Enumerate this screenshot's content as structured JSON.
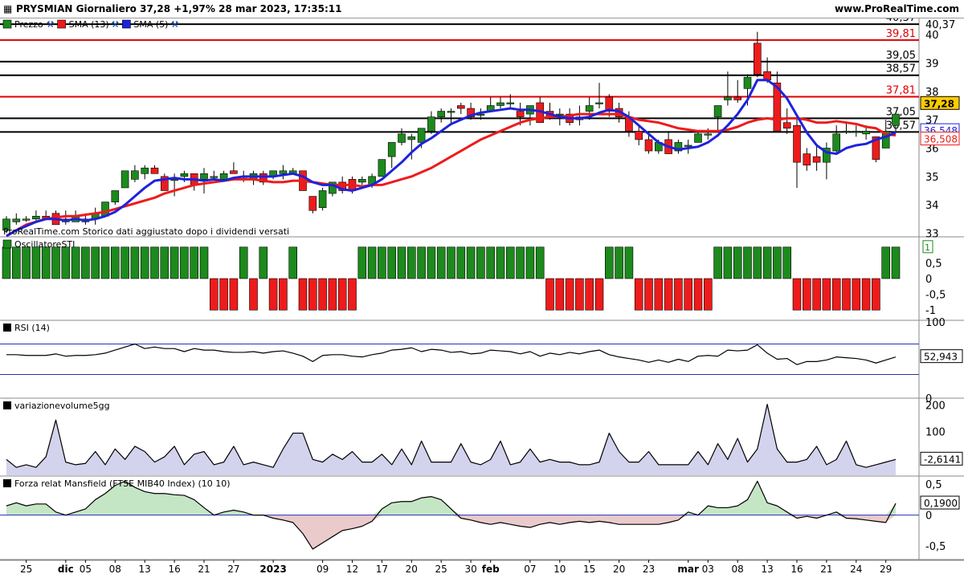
{
  "header": {
    "title": "PRYSMIAN Giornaliero 37,28 +1,97% 28 mar 2023, 17:35:11",
    "site": "www.ProRealTime.com"
  },
  "watermark": "ProRealTime.com",
  "note": "Storico dati aggiustato dopo i dividendi versati",
  "colors": {
    "up": "#1c8a1c",
    "down": "#ee1b1b",
    "sma13": "#ee1b1b",
    "sma5": "#1e22dd",
    "hline_black": "#000000",
    "hline_red": "#dd0000"
  },
  "chart_data": [
    {
      "type": "candlestick",
      "panel": "price",
      "legend": [
        "Prezzo",
        "SMA (13)",
        "SMA (5)"
      ],
      "y_ticks": [
        "33",
        "34",
        "35",
        "36",
        "37",
        "38",
        "39",
        "40",
        "40,37"
      ],
      "ylim": [
        32.9,
        40.6
      ],
      "x_tick_labels": [
        "25",
        "dic",
        "05",
        "08",
        "13",
        "16",
        "21",
        "27",
        "2023",
        "09",
        "12",
        "17",
        "20",
        "25",
        "30",
        "feb",
        "07",
        "10",
        "15",
        "20",
        "23",
        "mar",
        "03",
        "08",
        "13",
        "16",
        "21",
        "24",
        "29"
      ],
      "x_tick_index": [
        2,
        6,
        8,
        11,
        14,
        17,
        20,
        23,
        27,
        32,
        35,
        38,
        41,
        44,
        47,
        49,
        53,
        56,
        59,
        62,
        65,
        69,
        71,
        74,
        77,
        80,
        83,
        86,
        89
      ],
      "horizontal_levels": [
        {
          "value": 40.37,
          "label": "40,37",
          "color": "black"
        },
        {
          "value": 39.81,
          "label": "39,81",
          "color": "red"
        },
        {
          "value": 39.05,
          "label": "39,05",
          "color": "black"
        },
        {
          "value": 38.57,
          "label": "38,57",
          "color": "black"
        },
        {
          "value": 37.81,
          "label": "37,81",
          "color": "red"
        },
        {
          "value": 37.05,
          "label": "37,05",
          "color": "black"
        },
        {
          "value": 36.57,
          "label": "36,57",
          "color": "black"
        }
      ],
      "price_tags": [
        {
          "value": 37.28,
          "label": "37,28",
          "kind": "price"
        },
        {
          "value": 36.548,
          "label": "36,548",
          "kind": "sma5"
        },
        {
          "value": 36.508,
          "label": "36,508",
          "kind": "sma13"
        }
      ],
      "ohlc": [
        [
          33.1,
          33.6,
          33.0,
          33.5
        ],
        [
          33.4,
          33.7,
          33.3,
          33.5
        ],
        [
          33.5,
          33.6,
          33.4,
          33.5
        ],
        [
          33.5,
          33.8,
          33.4,
          33.6
        ],
        [
          33.6,
          33.8,
          33.5,
          33.5
        ],
        [
          33.7,
          33.8,
          33.3,
          33.3
        ],
        [
          33.4,
          33.8,
          33.3,
          33.5
        ],
        [
          33.4,
          33.8,
          33.4,
          33.6
        ],
        [
          33.4,
          33.7,
          33.3,
          33.5
        ],
        [
          33.5,
          33.9,
          33.3,
          33.7
        ],
        [
          33.6,
          34.1,
          33.6,
          34.1
        ],
        [
          34.1,
          34.5,
          34.0,
          34.5
        ],
        [
          34.6,
          35.2,
          34.6,
          35.2
        ],
        [
          34.9,
          35.4,
          34.8,
          35.2
        ],
        [
          35.1,
          35.4,
          34.9,
          35.3
        ],
        [
          35.3,
          35.4,
          35.1,
          35.1
        ],
        [
          35.0,
          35.1,
          34.5,
          34.5
        ],
        [
          34.9,
          35.1,
          34.3,
          34.9
        ],
        [
          35.0,
          35.2,
          34.8,
          35.1
        ],
        [
          35.1,
          35.1,
          34.5,
          34.7
        ],
        [
          34.9,
          35.3,
          34.4,
          35.1
        ],
        [
          35.0,
          35.2,
          34.9,
          35.0
        ],
        [
          34.9,
          35.2,
          34.9,
          35.1
        ],
        [
          35.2,
          35.5,
          35.1,
          35.1
        ],
        [
          35.0,
          35.2,
          34.8,
          35.0
        ],
        [
          34.9,
          35.2,
          34.7,
          35.1
        ],
        [
          35.1,
          35.2,
          34.7,
          34.8
        ],
        [
          35.0,
          35.2,
          34.9,
          35.2
        ],
        [
          35.1,
          35.4,
          34.9,
          35.2
        ],
        [
          35.1,
          35.3,
          35.1,
          35.2
        ],
        [
          35.2,
          35.2,
          34.5,
          34.5
        ],
        [
          34.3,
          34.3,
          33.7,
          33.8
        ],
        [
          33.9,
          34.6,
          33.8,
          34.5
        ],
        [
          34.4,
          34.8,
          34.3,
          34.8
        ],
        [
          34.8,
          35.0,
          34.4,
          34.5
        ],
        [
          34.9,
          35.0,
          34.4,
          34.5
        ],
        [
          34.8,
          35.0,
          34.7,
          34.9
        ],
        [
          34.7,
          35.1,
          34.6,
          35.0
        ],
        [
          35.0,
          35.6,
          35.0,
          35.6
        ],
        [
          35.7,
          36.2,
          35.3,
          36.2
        ],
        [
          36.2,
          36.7,
          36.1,
          36.5
        ],
        [
          36.3,
          36.5,
          35.6,
          36.4
        ],
        [
          36.2,
          36.7,
          36.0,
          36.7
        ],
        [
          36.6,
          37.3,
          36.5,
          37.1
        ],
        [
          37.1,
          37.4,
          36.9,
          37.3
        ],
        [
          37.3,
          37.4,
          36.8,
          37.3
        ],
        [
          37.5,
          37.6,
          37.2,
          37.4
        ],
        [
          37.4,
          37.6,
          37.0,
          37.1
        ],
        [
          37.2,
          37.4,
          37.0,
          37.2
        ],
        [
          37.3,
          37.8,
          37.3,
          37.5
        ],
        [
          37.5,
          37.8,
          37.4,
          37.6
        ],
        [
          37.6,
          37.9,
          37.4,
          37.6
        ],
        [
          37.3,
          37.6,
          36.8,
          37.1
        ],
        [
          37.2,
          37.5,
          36.8,
          37.5
        ],
        [
          37.6,
          37.8,
          36.9,
          36.9
        ],
        [
          37.3,
          37.6,
          37.0,
          37.1
        ],
        [
          37.2,
          37.4,
          36.8,
          37.2
        ],
        [
          37.2,
          37.4,
          36.8,
          36.9
        ],
        [
          37.1,
          37.5,
          36.8,
          37.0
        ],
        [
          37.3,
          37.8,
          37.0,
          37.5
        ],
        [
          37.6,
          38.3,
          37.4,
          37.6
        ],
        [
          37.8,
          37.9,
          37.1,
          37.3
        ],
        [
          37.4,
          37.6,
          36.9,
          37.1
        ],
        [
          37.1,
          37.3,
          36.4,
          36.6
        ],
        [
          36.6,
          36.8,
          36.1,
          36.3
        ],
        [
          36.3,
          36.6,
          35.8,
          35.9
        ],
        [
          35.9,
          36.3,
          35.8,
          36.2
        ],
        [
          36.3,
          36.6,
          35.8,
          35.8
        ],
        [
          35.9,
          36.3,
          35.8,
          36.2
        ],
        [
          36.1,
          36.3,
          35.8,
          36.1
        ],
        [
          36.2,
          36.6,
          36.2,
          36.5
        ],
        [
          36.5,
          36.7,
          36.3,
          36.5
        ],
        [
          37.1,
          37.5,
          36.6,
          37.5
        ],
        [
          37.7,
          38.7,
          37.5,
          37.8
        ],
        [
          37.8,
          38.4,
          37.6,
          37.7
        ],
        [
          38.1,
          38.6,
          37.5,
          38.5
        ],
        [
          39.7,
          40.1,
          38.5,
          38.6
        ],
        [
          38.7,
          39.2,
          38.3,
          38.4
        ],
        [
          38.3,
          38.7,
          36.6,
          36.6
        ],
        [
          36.9,
          37.4,
          36.5,
          36.7
        ],
        [
          36.8,
          37.1,
          34.6,
          35.5
        ],
        [
          35.8,
          36.0,
          35.2,
          35.4
        ],
        [
          35.7,
          36.1,
          35.2,
          35.5
        ],
        [
          35.5,
          36.2,
          34.9,
          36.0
        ],
        [
          35.9,
          36.8,
          35.8,
          36.5
        ],
        [
          36.6,
          36.9,
          36.5,
          36.6
        ],
        [
          36.6,
          36.8,
          36.4,
          36.6
        ],
        [
          36.5,
          36.8,
          36.3,
          36.6
        ],
        [
          36.4,
          36.4,
          35.5,
          35.6
        ],
        [
          36.0,
          37.0,
          36.0,
          36.6
        ],
        [
          36.8,
          37.1,
          36.6,
          37.2
        ]
      ],
      "sma13": [
        32.9,
        33.1,
        33.3,
        33.4,
        33.5,
        33.55,
        33.6,
        33.6,
        33.65,
        33.7,
        33.75,
        33.85,
        33.95,
        34.05,
        34.15,
        34.25,
        34.4,
        34.5,
        34.6,
        34.7,
        34.75,
        34.8,
        34.85,
        34.9,
        34.9,
        34.9,
        34.85,
        34.8,
        34.8,
        34.85,
        34.85,
        34.8,
        34.75,
        34.7,
        34.7,
        34.7,
        34.65,
        34.7,
        34.7,
        34.8,
        34.9,
        35.0,
        35.15,
        35.3,
        35.5,
        35.7,
        35.9,
        36.1,
        36.3,
        36.45,
        36.6,
        36.75,
        36.9,
        37.0,
        37.05,
        37.1,
        37.1,
        37.15,
        37.2,
        37.2,
        37.2,
        37.2,
        37.2,
        37.1,
        37.0,
        36.95,
        36.9,
        36.8,
        36.7,
        36.65,
        36.6,
        36.6,
        36.6,
        36.65,
        36.75,
        36.9,
        37.0,
        37.05,
        37.0,
        37.05,
        37.05,
        37.0,
        36.9,
        36.9,
        36.95,
        36.9,
        36.85,
        36.75,
        36.7,
        36.5,
        36.45
      ],
      "sma5": [
        32.9,
        33.1,
        33.25,
        33.4,
        33.5,
        33.5,
        33.45,
        33.5,
        33.45,
        33.5,
        33.6,
        33.75,
        34.0,
        34.3,
        34.6,
        34.85,
        34.9,
        34.95,
        34.9,
        34.9,
        34.85,
        34.9,
        34.85,
        34.95,
        35.0,
        35.0,
        35.0,
        35.0,
        35.05,
        35.1,
        35.0,
        34.8,
        34.7,
        34.7,
        34.55,
        34.5,
        34.6,
        34.7,
        34.9,
        35.2,
        35.5,
        35.85,
        36.15,
        36.35,
        36.6,
        36.85,
        37.0,
        37.15,
        37.25,
        37.3,
        37.35,
        37.4,
        37.35,
        37.35,
        37.3,
        37.2,
        37.1,
        37.05,
        37.05,
        37.1,
        37.25,
        37.35,
        37.3,
        37.1,
        36.8,
        36.5,
        36.2,
        36.05,
        35.95,
        36.0,
        36.05,
        36.2,
        36.45,
        36.8,
        37.2,
        37.7,
        38.4,
        38.4,
        38.15,
        37.75,
        37.15,
        36.55,
        36.1,
        35.85,
        35.8,
        36.0,
        36.1,
        36.15,
        36.3,
        36.4,
        36.55
      ]
    },
    {
      "type": "bar",
      "panel": "oscillator",
      "legend": [
        "OscillatoreSTI"
      ],
      "y_ticks": [
        "1",
        "0,5",
        "0",
        "-0,5",
        "-1"
      ],
      "ylim": [
        -1.3,
        1.3
      ],
      "last_value_label": "1",
      "values": [
        1,
        1,
        1,
        1,
        1,
        1,
        1,
        1,
        1,
        1,
        1,
        1,
        1,
        1,
        1,
        1,
        1,
        1,
        1,
        1,
        1,
        -1,
        -1,
        -1,
        1,
        -1,
        1,
        -1,
        -1,
        1,
        -1,
        -1,
        -1,
        -1,
        -1,
        -1,
        1,
        1,
        1,
        1,
        1,
        1,
        1,
        1,
        1,
        1,
        1,
        1,
        1,
        1,
        1,
        1,
        1,
        1,
        1,
        -1,
        -1,
        -1,
        -1,
        -1,
        -1,
        1,
        1,
        1,
        -1,
        -1,
        -1,
        -1,
        -1,
        -1,
        -1,
        -1,
        1,
        1,
        1,
        1,
        1,
        1,
        1,
        1,
        -1,
        -1,
        -1,
        -1,
        -1,
        -1,
        -1,
        -1,
        -1,
        1,
        1
      ]
    },
    {
      "type": "line",
      "panel": "rsi",
      "legend": [
        "RSI (14)"
      ],
      "y_ticks": [
        "100",
        "0"
      ],
      "ylim": [
        0,
        100
      ],
      "level_line": 70,
      "last_value_label": "52,943",
      "values": [
        56,
        56,
        55,
        55,
        55,
        57,
        54,
        55,
        55,
        56,
        58,
        62,
        66,
        70,
        64,
        66,
        64,
        64,
        60,
        64,
        62,
        62,
        60,
        59,
        59,
        60,
        58,
        60,
        61,
        58,
        54,
        47,
        55,
        56,
        56,
        54,
        53,
        56,
        58,
        62,
        63,
        65,
        60,
        63,
        62,
        59,
        60,
        57,
        58,
        62,
        61,
        60,
        57,
        60,
        54,
        58,
        56,
        59,
        57,
        60,
        62,
        56,
        53,
        51,
        49,
        46,
        49,
        46,
        50,
        47,
        54,
        55,
        54,
        62,
        61,
        62,
        69,
        58,
        50,
        51,
        43,
        47,
        47,
        49,
        53,
        52,
        51,
        49,
        45,
        49,
        53
      ]
    },
    {
      "type": "area",
      "panel": "volume",
      "legend": [
        "variazionevolume5gg"
      ],
      "y_ticks": [
        "200",
        "100"
      ],
      "ylim": [
        -70,
        220
      ],
      "last_value_label": "-2,6141",
      "values": [
        -10,
        -40,
        -30,
        -40,
        0,
        140,
        -20,
        -30,
        -25,
        20,
        -30,
        30,
        -10,
        40,
        20,
        -20,
        0,
        40,
        -30,
        10,
        20,
        -30,
        -20,
        40,
        -30,
        -20,
        -30,
        -40,
        30,
        90,
        90,
        -10,
        -20,
        10,
        -10,
        20,
        -20,
        -20,
        10,
        -30,
        30,
        -30,
        60,
        -20,
        -20,
        -20,
        50,
        -20,
        -30,
        -10,
        60,
        -30,
        -20,
        30,
        -20,
        -10,
        -20,
        -20,
        -30,
        -30,
        -20,
        90,
        20,
        -20,
        -20,
        20,
        -30,
        -30,
        -30,
        -30,
        20,
        -30,
        50,
        -10,
        70,
        -20,
        30,
        200,
        30,
        -20,
        -20,
        -10,
        40,
        -30,
        -10,
        60,
        -30,
        -40,
        -30,
        -20,
        -10
      ]
    },
    {
      "type": "area",
      "panel": "mansfield",
      "legend": [
        "Forza relat Mansfield (FTSE MIB40 Index) (10 10)"
      ],
      "y_ticks": [
        "0,5",
        "0",
        "-0,5"
      ],
      "ylim": [
        -0.72,
        0.62
      ],
      "last_value_label": "0,1900",
      "values": [
        0.15,
        0.2,
        0.15,
        0.18,
        0.18,
        0.05,
        0,
        0.05,
        0.1,
        0.25,
        0.35,
        0.48,
        0.55,
        0.45,
        0.38,
        0.35,
        0.35,
        0.33,
        0.32,
        0.25,
        0.12,
        0,
        0.05,
        0.08,
        0.05,
        0,
        0,
        -0.05,
        -0.08,
        -0.12,
        -0.3,
        -0.55,
        -0.45,
        -0.35,
        -0.25,
        -0.22,
        -0.18,
        -0.1,
        0.1,
        0.2,
        0.22,
        0.22,
        0.28,
        0.3,
        0.25,
        0.1,
        -0.05,
        -0.08,
        -0.12,
        -0.15,
        -0.12,
        -0.15,
        -0.18,
        -0.2,
        -0.15,
        -0.12,
        -0.15,
        -0.12,
        -0.1,
        -0.12,
        -0.1,
        -0.12,
        -0.15,
        -0.15,
        -0.15,
        -0.15,
        -0.15,
        -0.12,
        -0.08,
        0.05,
        0,
        0.15,
        0.12,
        0.12,
        0.15,
        0.25,
        0.55,
        0.2,
        0.15,
        0.05,
        -0.05,
        -0.02,
        -0.05,
        0,
        0.05,
        -0.05,
        -0.06,
        -0.08,
        -0.1,
        -0.12,
        0.19
      ]
    }
  ]
}
